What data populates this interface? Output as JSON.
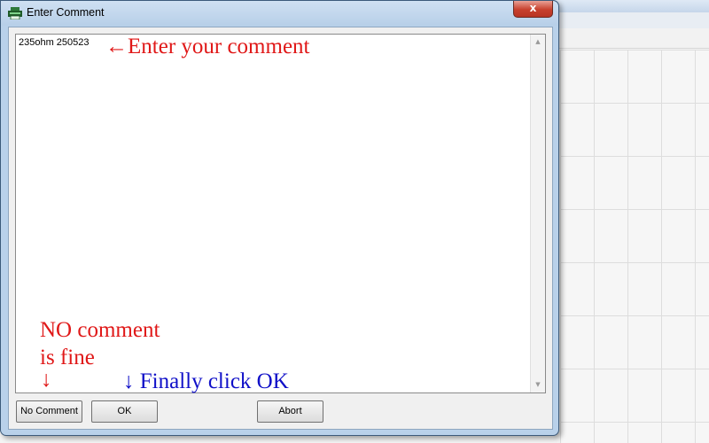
{
  "dialog": {
    "title": "Enter Comment",
    "close_label": "x",
    "comment_value": "235ohm 250523"
  },
  "annotations": {
    "enter_comment": "←Enter your comment",
    "no_comment_line1": "NO comment",
    "no_comment_line2": "is fine",
    "arrow_down": "↓",
    "finally_click_ok": "↓ Finally click OK"
  },
  "buttons": {
    "no_comment": "No Comment",
    "ok": "OK",
    "abort": "Abort"
  },
  "icons": {
    "app": "printer-icon",
    "close": "close-icon",
    "scroll_up": "scroll-up-arrow-icon",
    "scroll_down": "scroll-down-arrow-icon"
  },
  "colors": {
    "annotation_red": "#e01818",
    "annotation_blue": "#1010c8",
    "close_button": "#c7402d"
  }
}
